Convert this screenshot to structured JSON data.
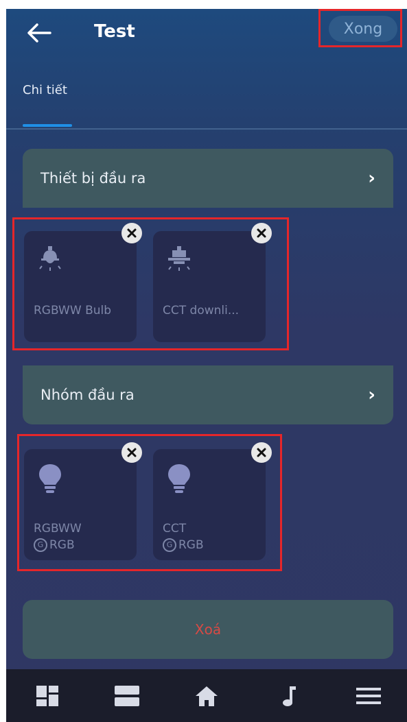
{
  "header": {
    "title": "Test",
    "done_label": "Xong"
  },
  "tabs": [
    {
      "label": "Chi tiết",
      "active": true
    }
  ],
  "output_devices": {
    "section_label": "Thiết bị đầu ra",
    "items": [
      {
        "label": "RGBWW Bulb",
        "icon": "ceiling-lamp-icon"
      },
      {
        "label": "CCT downli...",
        "icon": "downlight-icon"
      }
    ]
  },
  "output_groups": {
    "section_label": "Nhóm đầu ra",
    "items": [
      {
        "label": "RGBWW",
        "sub": "RGB",
        "sub_badge": "G",
        "icon": "lightbulb-icon"
      },
      {
        "label": "CCT",
        "sub": "RGB",
        "sub_badge": "G",
        "icon": "lightbulb-icon"
      }
    ]
  },
  "delete_label": "Xoá",
  "bottom_nav": [
    {
      "icon": "dashboard-icon"
    },
    {
      "icon": "list-icon"
    },
    {
      "icon": "home-icon"
    },
    {
      "icon": "music-note-icon"
    },
    {
      "icon": "menu-icon"
    }
  ],
  "colors": {
    "accent": "#1f8fe6",
    "delete": "#d84a45",
    "highlight": "#e5262a"
  }
}
